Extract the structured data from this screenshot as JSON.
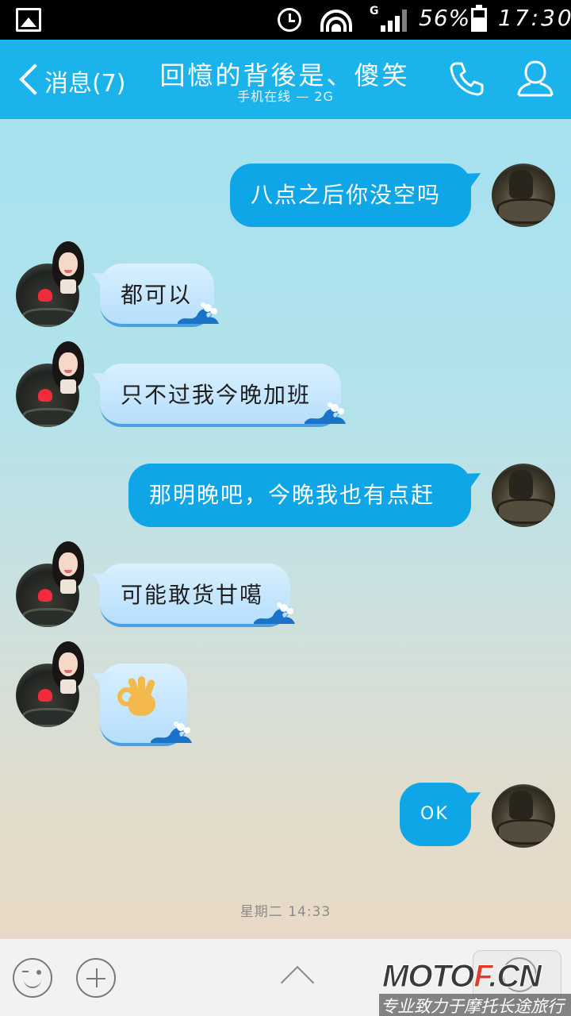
{
  "status_bar": {
    "network": "G",
    "battery": "56%",
    "time": "17:30"
  },
  "header": {
    "back_label": "消息(7)",
    "title": "回憶的背後是、傻笑",
    "subtitle": "手机在线 — 2G"
  },
  "chat": {
    "messages": [
      {
        "side": "out",
        "text": "八点之后你没空吗"
      },
      {
        "side": "in",
        "text": "都可以"
      },
      {
        "side": "in",
        "text": "只不过我今晚加班"
      },
      {
        "side": "out",
        "text": "那明晚吧，今晚我也有点赶"
      },
      {
        "side": "in",
        "text": "可能敢货甘噶"
      },
      {
        "side": "in",
        "text": "",
        "emoji": "ok-hand"
      },
      {
        "side": "out",
        "text": "OK"
      }
    ],
    "timestamp": "星期二 14:33"
  },
  "bottom_bar": {
    "buttons": [
      "emoji-icon",
      "plus-icon",
      "chevron-up-icon",
      "keyboard-icon"
    ]
  },
  "watermark": {
    "brand_prefix": "MOTO",
    "brand_accent": "F",
    "brand_suffix": ".CN",
    "tagline": "专业致力于摩托长途旅行"
  },
  "colors": {
    "header": "#1ab3ec",
    "outgoing_bubble": "#0ea6e6",
    "incoming_bubble": "#c6e7fe"
  }
}
